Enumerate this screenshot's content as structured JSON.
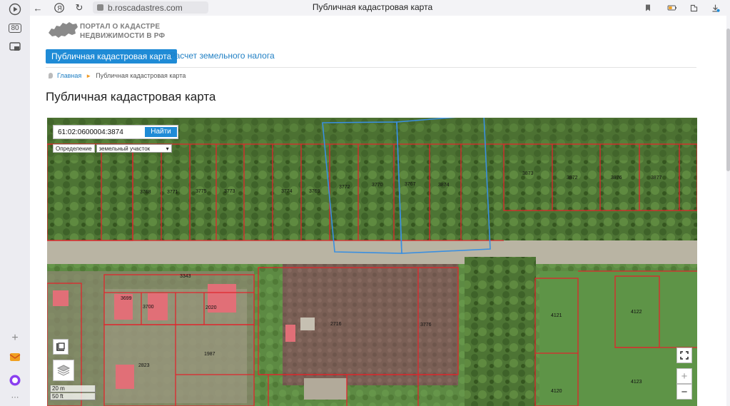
{
  "browser": {
    "url": "b.roscadastres.com",
    "tab_title": "Публичная кадастровая карта",
    "sidebar_badge": "80"
  },
  "site": {
    "logo_line1": "ПОРТАЛ О КАДАСТРЕ",
    "logo_line2": "НЕДВИЖИМОСТИ В РФ",
    "menu": {
      "active": "Публичная кадастровая карта",
      "link": "Расчет земельного налога"
    },
    "breadcrumb": {
      "home": "Главная",
      "current": "Публичная кадастровая карта"
    },
    "page_title": "Публичная кадастровая карта"
  },
  "map": {
    "search_value": "61:02:0600004:3874",
    "search_button": "Найти",
    "definition_label": "Определение",
    "definition_select": "земельный участок",
    "scale_metric": "20 m",
    "scale_imperial": "50 ft",
    "zoom_in": "+",
    "zoom_out": "−",
    "plot_labels": {
      "p3768": "3768",
      "p3771": "3771",
      "p3775": "3775",
      "p3773": "3773",
      "p3774": "3774",
      "p3769": "3769",
      "p3772": "3772",
      "p3770": "3770",
      "p3767": "3767",
      "p3874": "3874",
      "p3873": "3873",
      "p3872": "3872",
      "p3876": "3876",
      "p3877": "3877",
      "p3343": "3343",
      "p3699": "3699",
      "p3700": "3700",
      "p2020": "2020",
      "p2716": "2716",
      "p3776": "3776",
      "p4121": "4121",
      "p4122": "4122",
      "p1987": "1987",
      "p2823": "2823",
      "p4120": "4120",
      "p4123": "4123"
    },
    "colors": {
      "boundary": "#e0262c",
      "highlight": "#3a8fe0",
      "accent": "#1f8bd6"
    }
  }
}
